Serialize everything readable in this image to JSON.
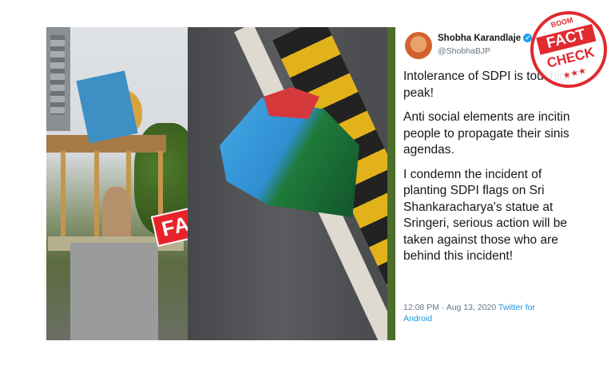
{
  "overlay": {
    "fake_label": "FAKE",
    "stamp": {
      "brand": "BOOM",
      "line1": "FACT",
      "line2": "CHECK",
      "stars": "★★★"
    }
  },
  "tweet": {
    "author_name": "Shobha Karandlaje",
    "verified_icon": "check-icon",
    "handle": "@ShobhaBJP",
    "paragraphs": [
      "Intolerance of SDPI is touching peak!",
      "Anti social elements are inciting people to propagate their sinister agendas.",
      "I condemn the incident of planting SDPI flags on Sri Shankaracharya's statue at Sringeri, serious action will be taken against those who are behind this incident!"
    ],
    "timestamp": "12:08 PM · Aug 13, 2020",
    "source_link": "Twitter for Android"
  },
  "colors": {
    "fake_red": "#e8242a",
    "stamp_red": "#e02a2f",
    "twitter_blue": "#1da1f2",
    "link_blue": "#1b95e0"
  }
}
